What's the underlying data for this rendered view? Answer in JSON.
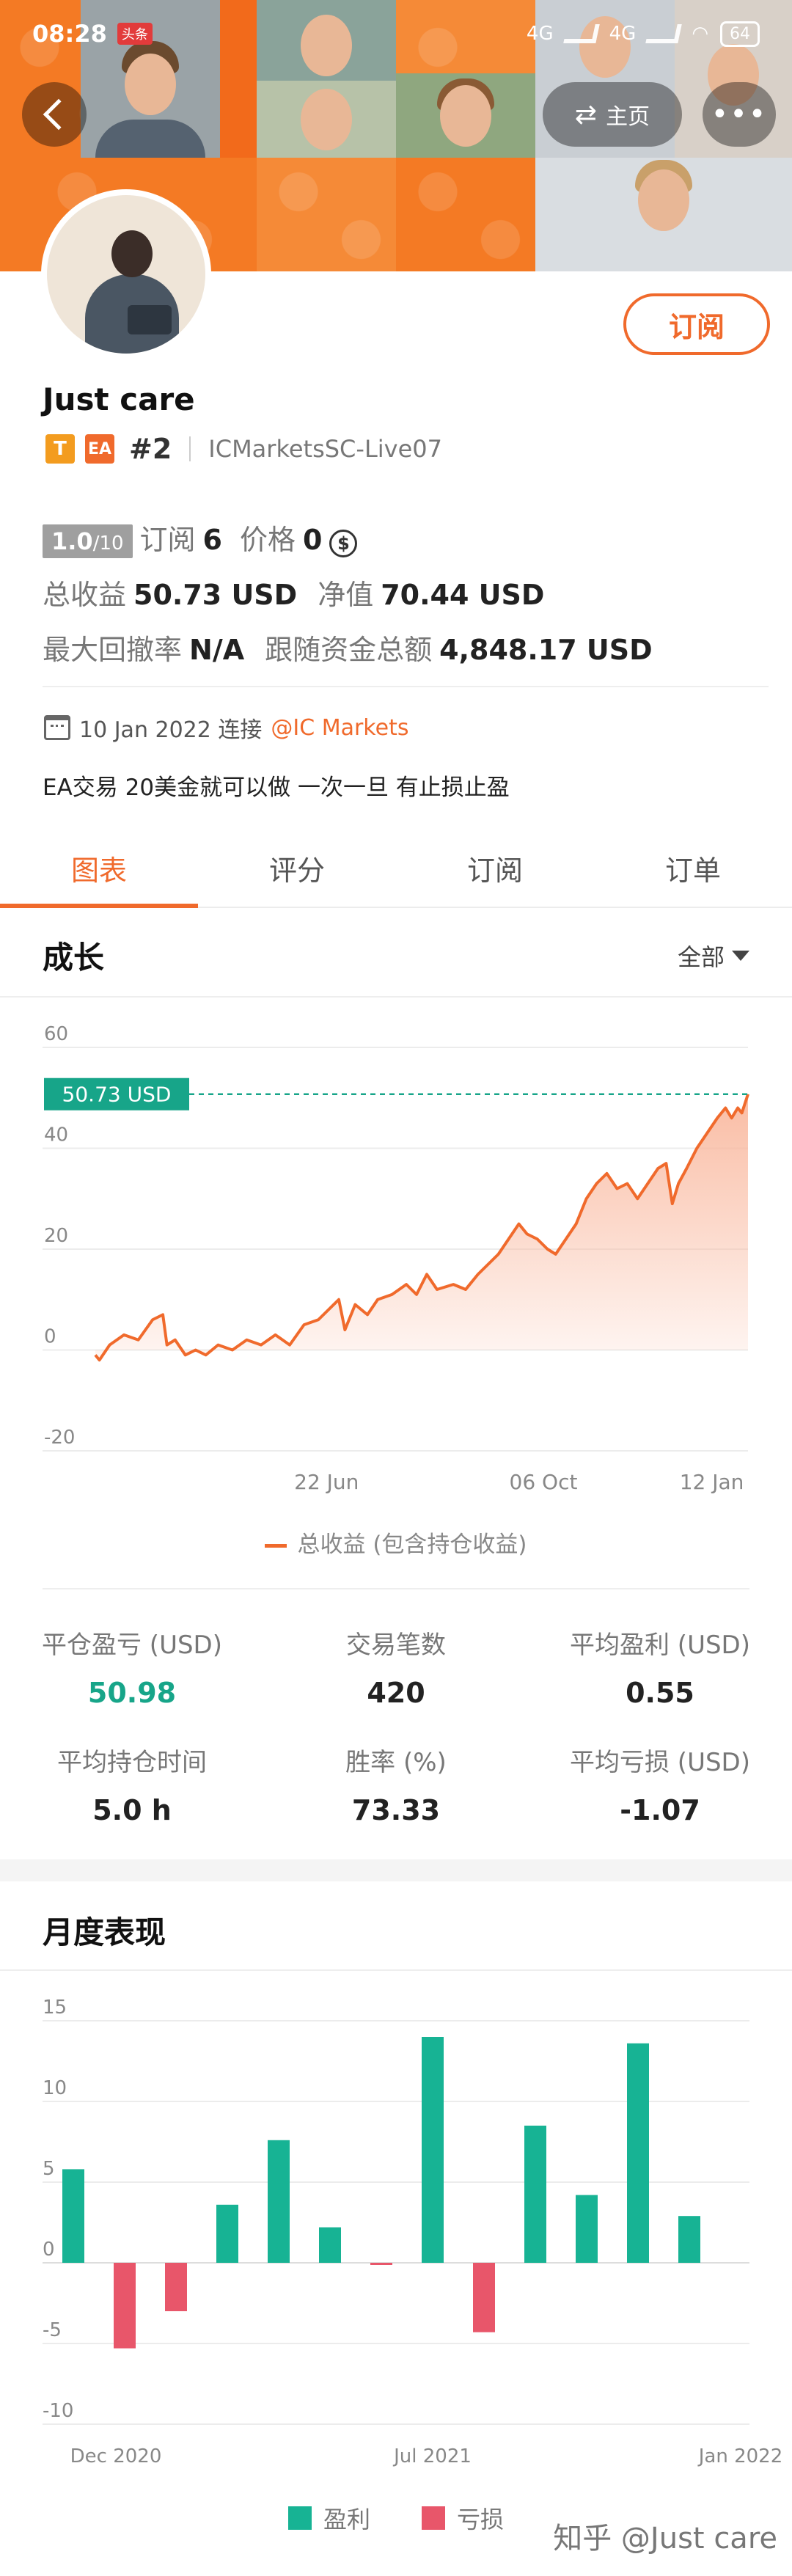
{
  "status_bar": {
    "time": "08:28",
    "badge": "头条",
    "net1": "4G",
    "net2": "4G",
    "battery": "64"
  },
  "header": {
    "home_label": "主页",
    "more_label": "•••"
  },
  "profile": {
    "name": "Just care",
    "tag_t": "T",
    "tag_ea": "EA",
    "rank": "#2",
    "server": "ICMarketsSC-Live07",
    "subscribe_label": "订阅",
    "score": "1.0",
    "score_max": "/10",
    "subs_label": "订阅",
    "subs_value": "6",
    "price_label": "价格",
    "price_value": "0",
    "total_profit_label": "总收益",
    "total_profit_value": "50.73 USD",
    "equity_label": "净值",
    "equity_value": "70.44 USD",
    "drawdown_label": "最大回撤率",
    "drawdown_value": "N/A",
    "follow_label": "跟随资金总额",
    "follow_value": "4,848.17 USD",
    "connect_date": "10 Jan 2022 连接",
    "broker": "@IC Markets",
    "description": "EA交易 20美金就可以做 一次一旦 有止损止盈"
  },
  "tabs": [
    {
      "label": "图表"
    },
    {
      "label": "评分"
    },
    {
      "label": "订阅"
    },
    {
      "label": "订单"
    }
  ],
  "growth": {
    "title": "成长",
    "filter_label": "全部",
    "legend_label": "总收益 (包含持仓收益)",
    "current_label": "50.73 USD",
    "colors": {
      "line": "#f06a2c",
      "fill_top": "#f9b59a",
      "label_bg": "#17a589"
    }
  },
  "metrics": {
    "closed_pl_label": "平仓盈亏 (USD)",
    "closed_pl_value": "50.98",
    "trades_label": "交易笔数",
    "trades_value": "420",
    "avg_profit_label": "平均盈利 (USD)",
    "avg_profit_value": "0.55",
    "avg_hold_label": "平均持仓时间",
    "avg_hold_value": "5.0 h",
    "win_rate_label": "胜率 (%)",
    "win_rate_value": "73.33",
    "avg_loss_label": "平均亏损 (USD)",
    "avg_loss_value": "-1.07"
  },
  "monthly": {
    "title": "月度表现",
    "legend_profit": "盈利",
    "legend_loss": "亏损",
    "colors": {
      "profit": "#17b394",
      "loss": "#e8566a"
    }
  },
  "watermark": "知乎 @Just care",
  "chart_data": [
    {
      "type": "area",
      "title": "成长",
      "ylim": [
        -20,
        60
      ],
      "yticks": [
        60,
        40,
        20,
        0,
        -20
      ],
      "xticks": [
        "22 Jun",
        "06 Oct",
        "12 Jan"
      ],
      "x_range": [
        "2021-03-01",
        "2022-01-14"
      ],
      "series": [
        {
          "name": "总收益 (包含持仓收益)",
          "points": [
            [
              "2021-03-01",
              -1
            ],
            [
              "2021-03-03",
              -2
            ],
            [
              "2021-03-08",
              1
            ],
            [
              "2021-03-15",
              3
            ],
            [
              "2021-03-22",
              2
            ],
            [
              "2021-03-29",
              6
            ],
            [
              "2021-04-03",
              7
            ],
            [
              "2021-04-05",
              1
            ],
            [
              "2021-04-09",
              2
            ],
            [
              "2021-04-14",
              -1
            ],
            [
              "2021-04-19",
              0
            ],
            [
              "2021-04-24",
              -1
            ],
            [
              "2021-04-30",
              1
            ],
            [
              "2021-05-07",
              0
            ],
            [
              "2021-05-14",
              2
            ],
            [
              "2021-05-21",
              1
            ],
            [
              "2021-05-28",
              3
            ],
            [
              "2021-06-04",
              1
            ],
            [
              "2021-06-11",
              5
            ],
            [
              "2021-06-18",
              6
            ],
            [
              "2021-06-23",
              8
            ],
            [
              "2021-06-28",
              10
            ],
            [
              "2021-07-01",
              4
            ],
            [
              "2021-07-06",
              9
            ],
            [
              "2021-07-12",
              7
            ],
            [
              "2021-07-17",
              10
            ],
            [
              "2021-07-24",
              11
            ],
            [
              "2021-07-31",
              13
            ],
            [
              "2021-08-05",
              11
            ],
            [
              "2021-08-10",
              15
            ],
            [
              "2021-08-15",
              12
            ],
            [
              "2021-08-23",
              13
            ],
            [
              "2021-08-29",
              12
            ],
            [
              "2021-09-04",
              15
            ],
            [
              "2021-09-09",
              17
            ],
            [
              "2021-09-14",
              19
            ],
            [
              "2021-09-19",
              22
            ],
            [
              "2021-09-24",
              25
            ],
            [
              "2021-09-28",
              23
            ],
            [
              "2021-10-03",
              22
            ],
            [
              "2021-10-08",
              20
            ],
            [
              "2021-10-12",
              19
            ],
            [
              "2021-10-17",
              22
            ],
            [
              "2021-10-22",
              25
            ],
            [
              "2021-10-27",
              30
            ],
            [
              "2021-11-01",
              33
            ],
            [
              "2021-11-06",
              35
            ],
            [
              "2021-11-11",
              32
            ],
            [
              "2021-11-16",
              33
            ],
            [
              "2021-11-21",
              30
            ],
            [
              "2021-11-26",
              33
            ],
            [
              "2021-12-01",
              36
            ],
            [
              "2021-12-05",
              37
            ],
            [
              "2021-12-08",
              29
            ],
            [
              "2021-12-11",
              33
            ],
            [
              "2021-12-15",
              36
            ],
            [
              "2021-12-20",
              40
            ],
            [
              "2021-12-25",
              43
            ],
            [
              "2021-12-30",
              46
            ],
            [
              "2022-01-03",
              48
            ],
            [
              "2022-01-06",
              46
            ],
            [
              "2022-01-09",
              48
            ],
            [
              "2022-01-11",
              47
            ],
            [
              "2022-01-14",
              50.73
            ]
          ]
        }
      ],
      "annotations": [
        "50.73 USD"
      ]
    },
    {
      "type": "bar",
      "title": "月度表现",
      "ylim": [
        -10,
        15
      ],
      "yticks": [
        15,
        10,
        5,
        0,
        -5,
        -10
      ],
      "xticks": [
        "Dec 2020",
        "Jul 2021",
        "Jan 2022"
      ],
      "categories": [
        "Dec 2020",
        "Jan 2021",
        "Feb 2021",
        "Mar 2021",
        "Apr 2021",
        "May 2021",
        "Jun 2021",
        "Jul 2021",
        "Aug 2021",
        "Sep 2021",
        "Oct 2021",
        "Nov 2021",
        "Dec 2021",
        "Jan 2022"
      ],
      "series": [
        {
          "name": "盈利",
          "values": [
            5.8,
            0,
            0,
            3.6,
            7.6,
            2.2,
            0,
            14.0,
            0,
            8.5,
            4.2,
            13.6,
            2.9,
            0
          ]
        },
        {
          "name": "亏损",
          "values": [
            0,
            -5.3,
            -3.0,
            0,
            0,
            0,
            -0.1,
            0,
            -4.3,
            0,
            0,
            0,
            0,
            0
          ]
        }
      ],
      "legend": "bottom-center"
    }
  ]
}
